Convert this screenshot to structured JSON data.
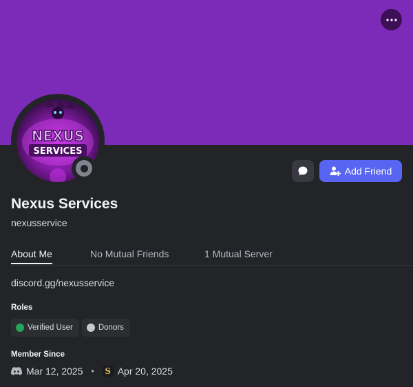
{
  "profile": {
    "display_name": "Nexus Services",
    "username": "nexusservice",
    "banner_color": "#7b2bb8",
    "avatar_text_line1": "NEXUS",
    "avatar_text_line2": "SERVICES",
    "status": "offline"
  },
  "actions": {
    "add_friend_label": "Add Friend",
    "message_icon": "chat-bubble-icon",
    "more_icon": "more-dots-icon"
  },
  "tabs": [
    {
      "label": "About Me",
      "active": true
    },
    {
      "label": "No Mutual Friends",
      "active": false
    },
    {
      "label": "1 Mutual Server",
      "active": false
    }
  ],
  "about": {
    "bio": "discord.gg/nexusservice"
  },
  "roles": {
    "title": "Roles",
    "items": [
      {
        "label": "Verified User",
        "color": "#23a55a"
      },
      {
        "label": "Donors",
        "color": "#c4c9ce"
      }
    ]
  },
  "member_since": {
    "title": "Member Since",
    "discord_date": "Mar 12, 2025",
    "separator": "•",
    "server_date": "Apr 20, 2025",
    "server_icon_letter": "S"
  },
  "colors": {
    "accent": "#5865f2",
    "background": "#232428"
  }
}
